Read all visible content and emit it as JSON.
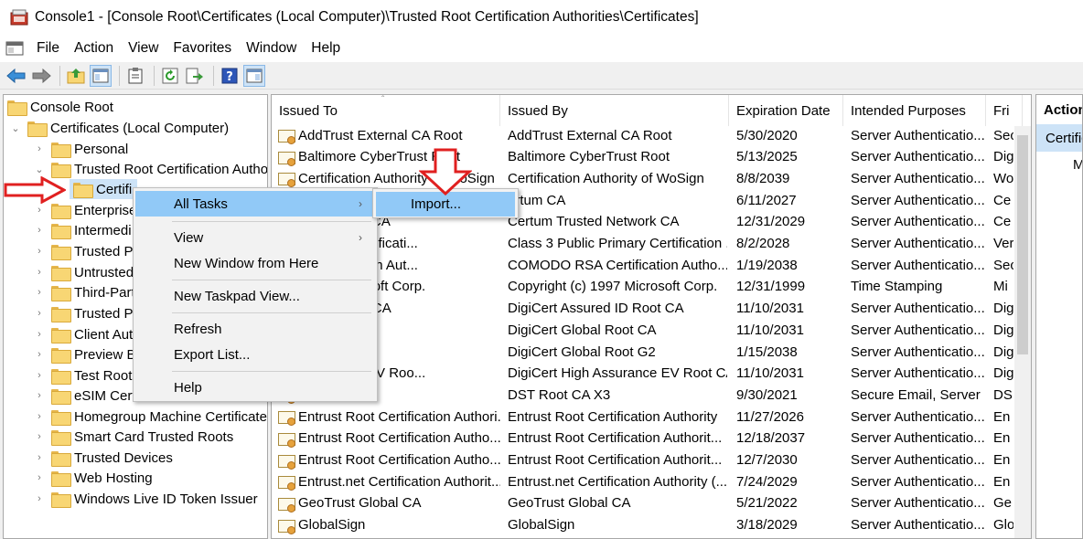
{
  "window": {
    "title": "Console1 - [Console Root\\Certificates (Local Computer)\\Trusted Root Certification Authorities\\Certificates]"
  },
  "menubar": [
    "File",
    "Action",
    "View",
    "Favorites",
    "Window",
    "Help"
  ],
  "toolbar": {
    "icons": [
      "back-arrow-icon",
      "forward-arrow-icon",
      "up-folder-icon",
      "show-hide-tree-icon",
      "clipboard-icon",
      "refresh-icon",
      "export-list-icon",
      "help-icon",
      "show-hide-action-pane-icon"
    ]
  },
  "tree": {
    "root": "Console Root",
    "certs_local": "Certificates (Local Computer)",
    "personal": "Personal",
    "trusted_root": "Trusted Root Certification Autho",
    "certificates_sub": "Certifi",
    "enterprise": "Enterprise",
    "intermediate": "Intermedi",
    "trusted_pub": "Trusted Pu",
    "untrusted": "Untrusted",
    "third_party": "Third-Part",
    "trusted_people": "Trusted Pe",
    "client_auth": "Client Aut",
    "preview_build": "Preview Bu",
    "test_roots": "Test Roots",
    "esim": "eSIM Cert",
    "homegroup": "Homegroup Machine Certificate",
    "smart_card": "Smart Card Trusted Roots",
    "trusted_devices": "Trusted Devices",
    "web_hosting": "Web Hosting",
    "windows_live": "Windows Live ID Token Issuer"
  },
  "list": {
    "columns": [
      "Issued To",
      "Issued By",
      "Expiration Date",
      "Intended Purposes",
      "Fri"
    ],
    "rows": [
      {
        "to": "AddTrust External CA Root",
        "by": "AddTrust External CA Root",
        "exp": "5/30/2020",
        "purpose": "Server Authenticatio...",
        "fri": "Sec"
      },
      {
        "to": "Baltimore CyberTrust Root",
        "by": "Baltimore CyberTrust Root",
        "exp": "5/13/2025",
        "purpose": "Server Authenticatio...",
        "fri": "Dig"
      },
      {
        "to": "Certification Authority of WoSign",
        "by": "Certification Authority of WoSign",
        "exp": "8/8/2039",
        "purpose": "Server Authenticatio...",
        "fri": "Wo"
      },
      {
        "to": "",
        "by": "ertum CA",
        "exp": "6/11/2027",
        "purpose": "Server Authenticatio...",
        "fri": "Ce"
      },
      {
        "to": "ed Network CA",
        "by": "Certum Trusted Network CA",
        "exp": "12/31/2029",
        "purpose": "Server Authenticatio...",
        "fri": "Ce"
      },
      {
        "to": "Primary Certificati...",
        "by": "Class 3 Public Primary Certification ...",
        "exp": "8/2/2028",
        "purpose": "Server Authenticatio...",
        "fri": "Ver"
      },
      {
        "to": "A Certification Aut...",
        "by": "COMODO RSA Certification Autho...",
        "exp": "1/19/2038",
        "purpose": "Server Authenticatio...",
        "fri": "Sec"
      },
      {
        "to": "1997 Microsoft Corp.",
        "by": "Copyright (c) 1997 Microsoft Corp.",
        "exp": "12/31/1999",
        "purpose": "Time Stamping",
        "fri": "Mi"
      },
      {
        "to": "red ID Root CA",
        "by": "DigiCert Assured ID Root CA",
        "exp": "11/10/2031",
        "purpose": "Server Authenticatio...",
        "fri": "Dig"
      },
      {
        "to": "al Root CA",
        "by": "DigiCert Global Root CA",
        "exp": "11/10/2031",
        "purpose": "Server Authenticatio...",
        "fri": "Dig"
      },
      {
        "to": "al Root G2",
        "by": "DigiCert Global Root G2",
        "exp": "1/15/2038",
        "purpose": "Server Authenticatio...",
        "fri": "Dig"
      },
      {
        "to": "Assurance EV Roo...",
        "by": "DigiCert High Assurance EV Root CA",
        "exp": "11/10/2031",
        "purpose": "Server Authenticatio...",
        "fri": "Dig"
      },
      {
        "to": "X3",
        "by": "DST Root CA X3",
        "exp": "9/30/2021",
        "purpose": "Secure Email, Server ...",
        "fri": "DS"
      },
      {
        "to": "Entrust Root Certification Authori...",
        "by": "Entrust Root Certification Authority",
        "exp": "11/27/2026",
        "purpose": "Server Authenticatio...",
        "fri": "En"
      },
      {
        "to": "Entrust Root Certification Autho...",
        "by": "Entrust Root Certification Authorit...",
        "exp": "12/18/2037",
        "purpose": "Server Authenticatio...",
        "fri": "En"
      },
      {
        "to": "Entrust Root Certification Autho...",
        "by": "Entrust Root Certification Authorit...",
        "exp": "12/7/2030",
        "purpose": "Server Authenticatio...",
        "fri": "En"
      },
      {
        "to": "Entrust.net Certification Authorit...",
        "by": "Entrust.net Certification Authority (...",
        "exp": "7/24/2029",
        "purpose": "Server Authenticatio...",
        "fri": "En"
      },
      {
        "to": "GeoTrust Global CA",
        "by": "GeoTrust Global CA",
        "exp": "5/21/2022",
        "purpose": "Server Authenticatio...",
        "fri": "Ge"
      },
      {
        "to": "GlobalSign",
        "by": "GlobalSign",
        "exp": "3/18/2029",
        "purpose": "Server Authenticatio...",
        "fri": "Glo"
      }
    ]
  },
  "actions": {
    "title": "Action",
    "item": "Certific",
    "more": "M"
  },
  "context_menu": {
    "all_tasks": "All Tasks",
    "view": "View",
    "new_window": "New Window from Here",
    "new_taskpad": "New Taskpad View...",
    "refresh": "Refresh",
    "export_list": "Export List...",
    "help": "Help"
  },
  "submenu": {
    "import": "Import..."
  },
  "colors": {
    "highlight": "#91c9f7",
    "arrow_red": "#e02020"
  }
}
